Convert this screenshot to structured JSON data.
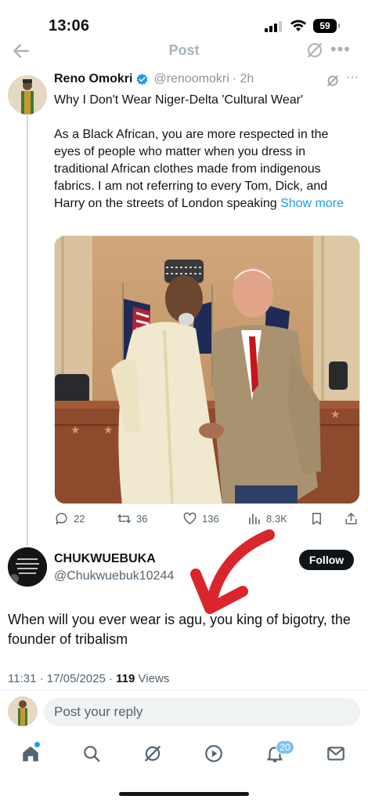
{
  "status_bar": {
    "time": "13:06",
    "battery": "59"
  },
  "nav": {
    "title": "Post"
  },
  "tweet": {
    "name": "Reno Omokri",
    "handle": "@renoomokri",
    "time": "· 2h",
    "title_line": "Why I Don't Wear Niger-Delta 'Cultural Wear'",
    "body": "As a Black African, you are more respected in the eyes of people who matter when you dress in traditional African clothes made from indigenous fabrics. I am not referring to every Tom, Dick, and Harry on the streets of London speaking",
    "show_more": "Show more",
    "stats": {
      "replies": "22",
      "reposts": "36",
      "likes": "136",
      "views": "8.3K"
    }
  },
  "reply": {
    "name": "CHUKWUEBUKA",
    "handle": "@Chukwuebuk10244",
    "follow_label": "Follow",
    "text": "When will you ever wear is agu, you king of bigotry, the founder of tribalism",
    "timestamp": "11:31 · 17/05/2025 · ",
    "views_count": "119",
    "views_label": " Views"
  },
  "compose": {
    "placeholder": "Post your reply"
  },
  "tabbar": {
    "notifications_badge": "20"
  },
  "colors": {
    "accent": "#1d9bf0",
    "arrow": "#d9252b",
    "follow_bg": "#0f1419"
  }
}
